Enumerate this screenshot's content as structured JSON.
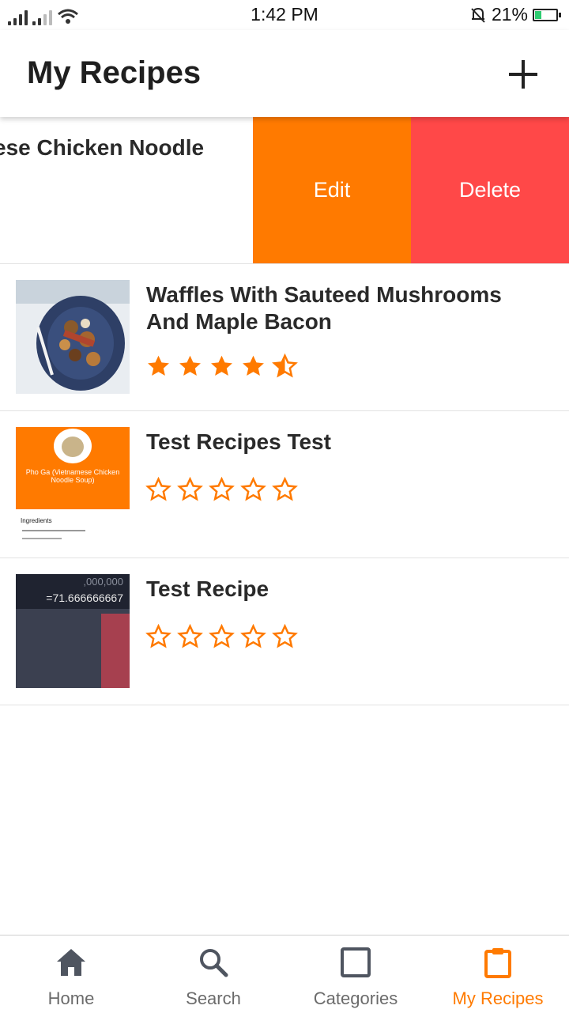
{
  "status_bar": {
    "time": "1:42 PM",
    "battery": "21%"
  },
  "app_bar": {
    "title": "My Recipes",
    "add_icon": "plus-icon"
  },
  "swiped_row": {
    "title_visible": "ese Chicken Noodle",
    "edit_label": "Edit",
    "delete_label": "Delete"
  },
  "recipes": [
    {
      "title": "Waffles With Sauteed Mushrooms And Maple Bacon",
      "rating": 4.5
    },
    {
      "title": "Test Recipes Test",
      "rating": 0,
      "thumb_text": {
        "name": "Pho Ga (Vietnamese Chicken Noodle Soup)",
        "section": "Ingredients"
      }
    },
    {
      "title": "Test Recipe",
      "rating": 0,
      "thumb_text": {
        "top": ",000,000",
        "result": "=71.666666667"
      }
    }
  ],
  "bottom_nav": [
    {
      "label": "Home",
      "icon": "home-icon"
    },
    {
      "label": "Search",
      "icon": "search-icon"
    },
    {
      "label": "Categories",
      "icon": "square-icon"
    },
    {
      "label": "My Recipes",
      "icon": "clipboard-icon",
      "active": true
    }
  ],
  "colors": {
    "accent": "#ff7a00",
    "delete": "#ff4848",
    "nav_inactive": "#6b6b6b"
  }
}
